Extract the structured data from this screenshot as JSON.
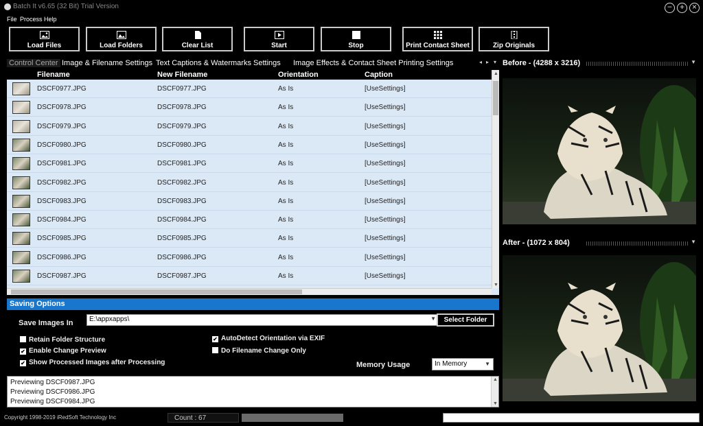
{
  "window": {
    "title": "Batch It v6.65 (32 Bit) Trial Version",
    "controls": [
      "−",
      "+",
      "×"
    ]
  },
  "menu": [
    "File",
    "Process",
    "Help"
  ],
  "toolbar": [
    {
      "label": "Load Files",
      "icon": "image-icon"
    },
    {
      "label": "Load Folders",
      "icon": "folder-image-icon"
    },
    {
      "label": "Clear List",
      "icon": "document-icon"
    },
    {
      "label": "Start",
      "icon": "play-icon"
    },
    {
      "label": "Stop",
      "icon": "stop-icon"
    },
    {
      "label": "Print Contact Sheet",
      "icon": "grid-icon"
    },
    {
      "label": "Zip Originals",
      "icon": "zip-icon"
    }
  ],
  "tabs": [
    "Control Center",
    "Image & Filename Settings",
    "Text Captions & Watermarks Settings",
    "Image Effects & Contact Sheet Printing Settings"
  ],
  "grid": {
    "columns": [
      "Filename",
      "New Filename",
      "Orientation",
      "Caption"
    ],
    "rows": [
      [
        "DSCF0977.JPG",
        "DSCF0977.JPG",
        "As Is",
        "[UseSettings]"
      ],
      [
        "DSCF0978.JPG",
        "DSCF0978.JPG",
        "As Is",
        "[UseSettings]"
      ],
      [
        "DSCF0979.JPG",
        "DSCF0979.JPG",
        "As Is",
        "[UseSettings]"
      ],
      [
        "DSCF0980.JPG",
        "DSCF0980.JPG",
        "As Is",
        "[UseSettings]"
      ],
      [
        "DSCF0981.JPG",
        "DSCF0981.JPG",
        "As Is",
        "[UseSettings]"
      ],
      [
        "DSCF0982.JPG",
        "DSCF0982.JPG",
        "As Is",
        "[UseSettings]"
      ],
      [
        "DSCF0983.JPG",
        "DSCF0983.JPG",
        "As Is",
        "[UseSettings]"
      ],
      [
        "DSCF0984.JPG",
        "DSCF0984.JPG",
        "As Is",
        "[UseSettings]"
      ],
      [
        "DSCF0985.JPG",
        "DSCF0985.JPG",
        "As Is",
        "[UseSettings]"
      ],
      [
        "DSCF0986.JPG",
        "DSCF0986.JPG",
        "As Is",
        "[UseSettings]"
      ],
      [
        "DSCF0987.JPG",
        "DSCF0987.JPG",
        "As Is",
        "[UseSettings]"
      ]
    ]
  },
  "saving": {
    "header": "Saving Options",
    "save_label": "Save Images In",
    "path": "E:\\appxapps\\",
    "select_folder": "Select Folder",
    "checkboxes": [
      {
        "label": "Retain Folder Structure",
        "checked": false
      },
      {
        "label": "Enable Change Preview",
        "checked": true
      },
      {
        "label": "Show Processed Images after Processing",
        "checked": true
      },
      {
        "label": "AutoDetect Orientation via EXIF",
        "checked": true
      },
      {
        "label": "Do Filename Change Only",
        "checked": false
      }
    ],
    "memory_label": "Memory Usage",
    "memory_value": "In Memory"
  },
  "log": [
    "Previewing DSCF0987.JPG",
    "Previewing DSCF0986.JPG",
    "Previewing DSCF0984.JPG"
  ],
  "status": {
    "copyright": "Copyright 1998-2019 iRedSoft Technology Inc",
    "count": "Count : 67"
  },
  "preview": {
    "before": "Before - (4288 x 3216)",
    "after": "After - (1072 x 804)"
  },
  "colors": {
    "accent": "#1877cc",
    "grid_bg": "#dbe8f6",
    "background": "#000000"
  }
}
